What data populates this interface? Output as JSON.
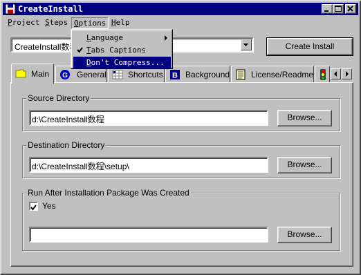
{
  "window": {
    "title": "CreateInstall"
  },
  "menubar": [
    {
      "id": "project",
      "pre": "",
      "u": "P",
      "post": "roject"
    },
    {
      "id": "steps",
      "pre": "",
      "u": "S",
      "post": "teps"
    },
    {
      "id": "options",
      "pre": "",
      "u": "O",
      "post": "ptions"
    },
    {
      "id": "help",
      "pre": "",
      "u": "H",
      "post": "elp"
    }
  ],
  "options_menu": {
    "items": [
      {
        "pre": "",
        "u": "L",
        "post": "anguage",
        "submenu": true,
        "checked": false,
        "highlighted": false
      },
      {
        "pre": "",
        "u": "T",
        "post": "abs Captions",
        "submenu": false,
        "checked": true,
        "highlighted": false
      },
      {
        "pre": "",
        "u": "D",
        "post": "on't Compress...",
        "submenu": false,
        "checked": false,
        "highlighted": true
      }
    ]
  },
  "project_combo": {
    "value": "CreateInstall数程"
  },
  "create_install_button": "Create Install",
  "tabs": [
    {
      "label": "Main",
      "icon": "folder-icon",
      "active": true
    },
    {
      "label": "General",
      "icon": "g-circle-icon",
      "active": false
    },
    {
      "label": "Shortcuts",
      "icon": "shortcuts-grid-icon",
      "active": false
    },
    {
      "label": "Background",
      "icon": "b-square-icon",
      "active": false
    },
    {
      "label": "License/Readme",
      "icon": "document-icon",
      "active": false
    }
  ],
  "source": {
    "legend": "Source Directory",
    "value": "d:\\CreateInstall数程",
    "browse": "Browse..."
  },
  "destination": {
    "legend": "Destination Directory",
    "value": "d:\\CreateInstall数程\\setup\\",
    "browse": "Browse..."
  },
  "run_after": {
    "legend": "Run After Installation Package Was Created",
    "checkbox_label": "Yes",
    "checked": true,
    "value": "",
    "browse": "Browse..."
  }
}
